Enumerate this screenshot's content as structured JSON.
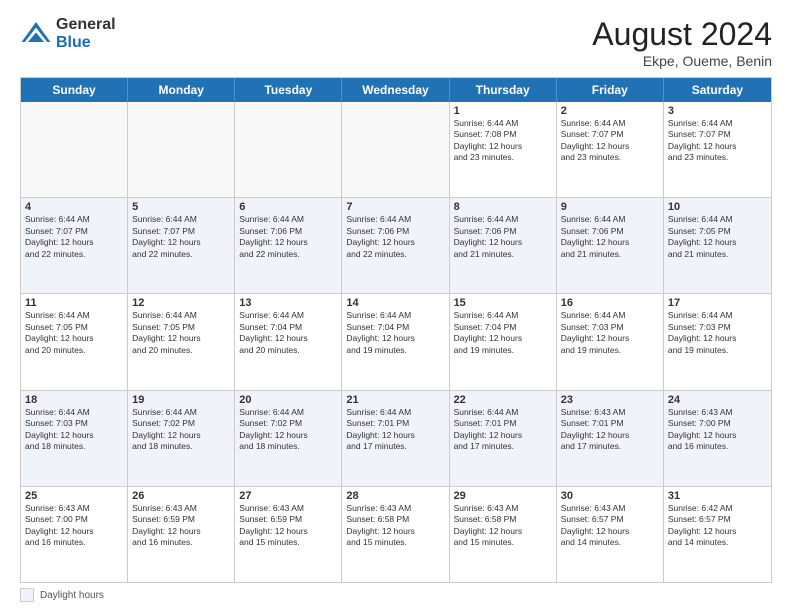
{
  "logo": {
    "general": "General",
    "blue": "Blue"
  },
  "title": {
    "month_year": "August 2024",
    "location": "Ekpe, Oueme, Benin"
  },
  "header_days": [
    "Sunday",
    "Monday",
    "Tuesday",
    "Wednesday",
    "Thursday",
    "Friday",
    "Saturday"
  ],
  "weeks": [
    {
      "alt": false,
      "cells": [
        {
          "day": "",
          "info": ""
        },
        {
          "day": "",
          "info": ""
        },
        {
          "day": "",
          "info": ""
        },
        {
          "day": "",
          "info": ""
        },
        {
          "day": "1",
          "info": "Sunrise: 6:44 AM\nSunset: 7:08 PM\nDaylight: 12 hours\nand 23 minutes."
        },
        {
          "day": "2",
          "info": "Sunrise: 6:44 AM\nSunset: 7:07 PM\nDaylight: 12 hours\nand 23 minutes."
        },
        {
          "day": "3",
          "info": "Sunrise: 6:44 AM\nSunset: 7:07 PM\nDaylight: 12 hours\nand 23 minutes."
        }
      ]
    },
    {
      "alt": true,
      "cells": [
        {
          "day": "4",
          "info": "Sunrise: 6:44 AM\nSunset: 7:07 PM\nDaylight: 12 hours\nand 22 minutes."
        },
        {
          "day": "5",
          "info": "Sunrise: 6:44 AM\nSunset: 7:07 PM\nDaylight: 12 hours\nand 22 minutes."
        },
        {
          "day": "6",
          "info": "Sunrise: 6:44 AM\nSunset: 7:06 PM\nDaylight: 12 hours\nand 22 minutes."
        },
        {
          "day": "7",
          "info": "Sunrise: 6:44 AM\nSunset: 7:06 PM\nDaylight: 12 hours\nand 22 minutes."
        },
        {
          "day": "8",
          "info": "Sunrise: 6:44 AM\nSunset: 7:06 PM\nDaylight: 12 hours\nand 21 minutes."
        },
        {
          "day": "9",
          "info": "Sunrise: 6:44 AM\nSunset: 7:06 PM\nDaylight: 12 hours\nand 21 minutes."
        },
        {
          "day": "10",
          "info": "Sunrise: 6:44 AM\nSunset: 7:05 PM\nDaylight: 12 hours\nand 21 minutes."
        }
      ]
    },
    {
      "alt": false,
      "cells": [
        {
          "day": "11",
          "info": "Sunrise: 6:44 AM\nSunset: 7:05 PM\nDaylight: 12 hours\nand 20 minutes."
        },
        {
          "day": "12",
          "info": "Sunrise: 6:44 AM\nSunset: 7:05 PM\nDaylight: 12 hours\nand 20 minutes."
        },
        {
          "day": "13",
          "info": "Sunrise: 6:44 AM\nSunset: 7:04 PM\nDaylight: 12 hours\nand 20 minutes."
        },
        {
          "day": "14",
          "info": "Sunrise: 6:44 AM\nSunset: 7:04 PM\nDaylight: 12 hours\nand 19 minutes."
        },
        {
          "day": "15",
          "info": "Sunrise: 6:44 AM\nSunset: 7:04 PM\nDaylight: 12 hours\nand 19 minutes."
        },
        {
          "day": "16",
          "info": "Sunrise: 6:44 AM\nSunset: 7:03 PM\nDaylight: 12 hours\nand 19 minutes."
        },
        {
          "day": "17",
          "info": "Sunrise: 6:44 AM\nSunset: 7:03 PM\nDaylight: 12 hours\nand 19 minutes."
        }
      ]
    },
    {
      "alt": true,
      "cells": [
        {
          "day": "18",
          "info": "Sunrise: 6:44 AM\nSunset: 7:03 PM\nDaylight: 12 hours\nand 18 minutes."
        },
        {
          "day": "19",
          "info": "Sunrise: 6:44 AM\nSunset: 7:02 PM\nDaylight: 12 hours\nand 18 minutes."
        },
        {
          "day": "20",
          "info": "Sunrise: 6:44 AM\nSunset: 7:02 PM\nDaylight: 12 hours\nand 18 minutes."
        },
        {
          "day": "21",
          "info": "Sunrise: 6:44 AM\nSunset: 7:01 PM\nDaylight: 12 hours\nand 17 minutes."
        },
        {
          "day": "22",
          "info": "Sunrise: 6:44 AM\nSunset: 7:01 PM\nDaylight: 12 hours\nand 17 minutes."
        },
        {
          "day": "23",
          "info": "Sunrise: 6:43 AM\nSunset: 7:01 PM\nDaylight: 12 hours\nand 17 minutes."
        },
        {
          "day": "24",
          "info": "Sunrise: 6:43 AM\nSunset: 7:00 PM\nDaylight: 12 hours\nand 16 minutes."
        }
      ]
    },
    {
      "alt": false,
      "cells": [
        {
          "day": "25",
          "info": "Sunrise: 6:43 AM\nSunset: 7:00 PM\nDaylight: 12 hours\nand 16 minutes."
        },
        {
          "day": "26",
          "info": "Sunrise: 6:43 AM\nSunset: 6:59 PM\nDaylight: 12 hours\nand 16 minutes."
        },
        {
          "day": "27",
          "info": "Sunrise: 6:43 AM\nSunset: 6:59 PM\nDaylight: 12 hours\nand 15 minutes."
        },
        {
          "day": "28",
          "info": "Sunrise: 6:43 AM\nSunset: 6:58 PM\nDaylight: 12 hours\nand 15 minutes."
        },
        {
          "day": "29",
          "info": "Sunrise: 6:43 AM\nSunset: 6:58 PM\nDaylight: 12 hours\nand 15 minutes."
        },
        {
          "day": "30",
          "info": "Sunrise: 6:43 AM\nSunset: 6:57 PM\nDaylight: 12 hours\nand 14 minutes."
        },
        {
          "day": "31",
          "info": "Sunrise: 6:42 AM\nSunset: 6:57 PM\nDaylight: 12 hours\nand 14 minutes."
        }
      ]
    }
  ],
  "footer": {
    "legend_label": "Daylight hours"
  }
}
